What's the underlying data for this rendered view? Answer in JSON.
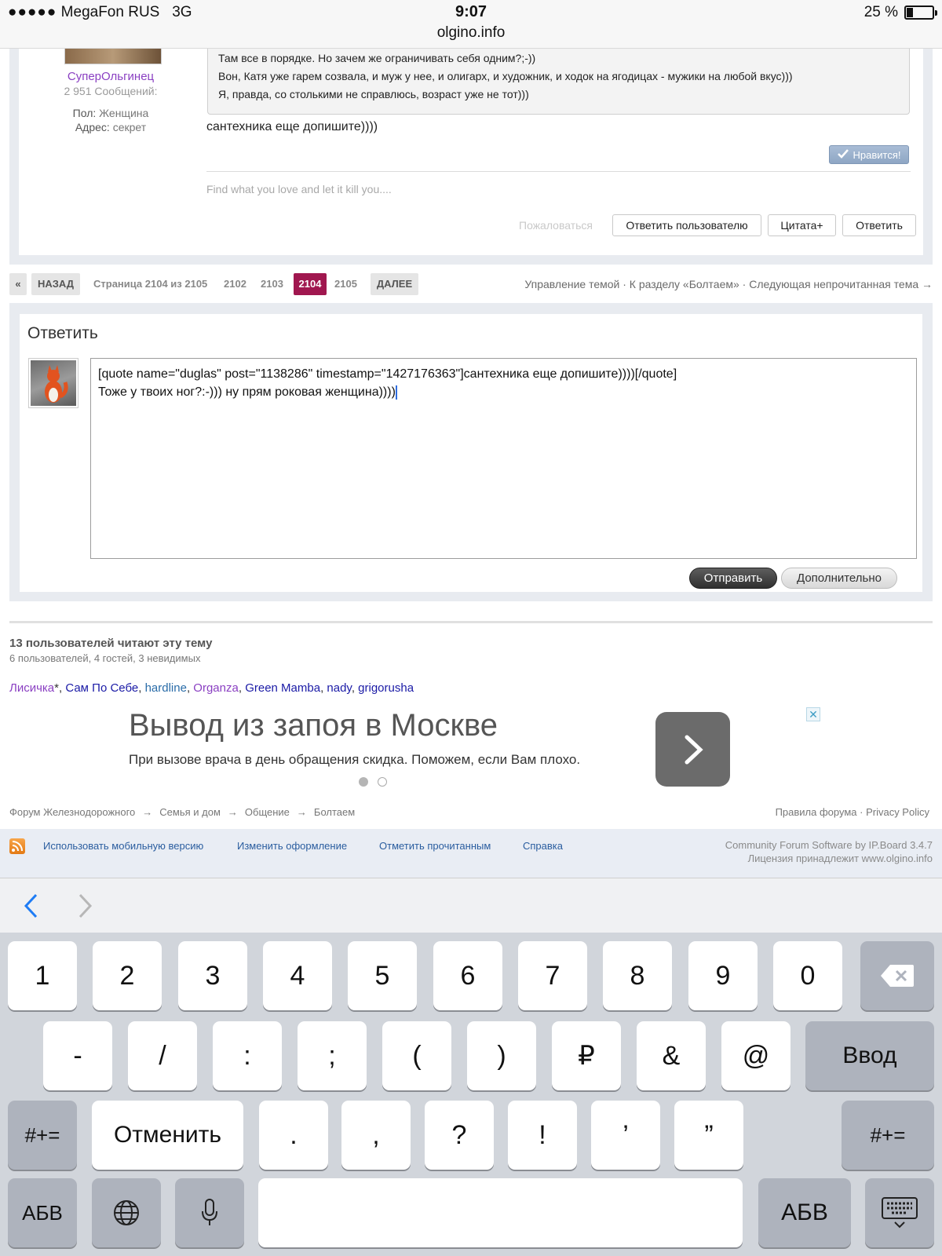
{
  "status_bar": {
    "signal": "●●●●●",
    "carrier": "MegaFon RUS",
    "network": "3G",
    "time": "9:07",
    "url": "olgino.info",
    "battery_text": "25 %",
    "battery_level": 0.25
  },
  "post": {
    "author_name": "СуперОльгинец",
    "author_posts": "2 951 Сообщений:",
    "gender_label": "Пол:",
    "gender_value": "Женщина",
    "address_label": "Адрес:",
    "address_value": "секрет",
    "quote_lines": [
      "Там все в порядке. Но зачем же ограничивать себя одним?;-))",
      "Вон, Катя уже гарем созвала, и муж у нее, и олигарх, и художник, и ходок на ягодицах - мужики на любой вкус)))",
      "Я, правда, со столькими не справлюсь, возраст уже не тот)))"
    ],
    "text": "сантехника еще допишите))))",
    "like_label": "Нравится!",
    "signature": "Find what you love and let it kill you....",
    "report_label": "Пожаловаться",
    "reply_user_label": "Ответить пользователю",
    "quote_plus_label": "Цитата+",
    "reply_label": "Ответить"
  },
  "pagination": {
    "first": "«",
    "back": "НАЗАД",
    "page_info": "Страница 2104 из 2105",
    "pages": [
      "2102",
      "2103",
      "2104",
      "2105"
    ],
    "current": "2104",
    "next": "ДАЛЕЕ",
    "right_text": "Управление темой · К разделу «Болтаем» · Следующая непрочитанная тема →"
  },
  "reply": {
    "title": "Ответить",
    "text_line1": "[quote name=\"duglas\" post=\"1138286\" timestamp=\"1427176363\"]сантехника еще допишите))))[/quote]",
    "text_line2": "Тоже у твоих ног?:-))) ну прям роковая женщина))))",
    "send_label": "Отправить",
    "more_label": "Дополнительно"
  },
  "readers": {
    "title": "13 пользователей читают эту тему",
    "subtitle": "6 пользователей, 4 гостей, 3 невидимых",
    "users": [
      {
        "name": "Лисичка",
        "suffix": "*",
        "color": "#8a3fc2"
      },
      {
        "name": "Сам По Себе",
        "suffix": "",
        "color": "#1a1aa6"
      },
      {
        "name": "hardline",
        "suffix": "",
        "color": "#2a6ca8"
      },
      {
        "name": "Organza",
        "suffix": "",
        "color": "#8a3fc2"
      },
      {
        "name": "Green Mamba",
        "suffix": "",
        "color": "#1a1aa6"
      },
      {
        "name": "nady",
        "suffix": "",
        "color": "#1a1aa6"
      },
      {
        "name": "grigorusha",
        "suffix": "",
        "color": "#1a1aa6"
      }
    ]
  },
  "ad": {
    "title": "Вывод из запоя в Москве",
    "text": "При вызове врача в день обращения скидка. Поможем, если Вам плохо.",
    "close": "✕"
  },
  "breadcrumb": {
    "items": [
      "Форум Железнодорожного",
      "Семья и дом",
      "Общение",
      "Болтаем"
    ],
    "arrow": "→"
  },
  "footer": {
    "rules": "Правила форума",
    "privacy": "Privacy Policy",
    "links": [
      "Использовать мобильную версию",
      "Изменить оформление",
      "Отметить прочитанным",
      "Справка"
    ],
    "copy_line1": "Community Forum Software by IP.Board 3.4.7",
    "copy_line2": "Лицензия принадлежит www.olgino.info"
  },
  "keyboard": {
    "row1": [
      "1",
      "2",
      "3",
      "4",
      "5",
      "6",
      "7",
      "8",
      "9",
      "0"
    ],
    "row2": [
      "-",
      "/",
      ":",
      ";",
      "(",
      ")",
      "₽",
      "&",
      "@"
    ],
    "enter": "Ввод",
    "row3_mid": [
      ".",
      ",",
      "?",
      "!",
      "’",
      "”"
    ],
    "symbols": "#+=",
    "undo": "Отменить",
    "abc": "АБВ"
  },
  "colors": {
    "accent_current_page": "#a0174f",
    "link_blue": "#2a5d9f",
    "username_purple": "#8a3fc2"
  }
}
